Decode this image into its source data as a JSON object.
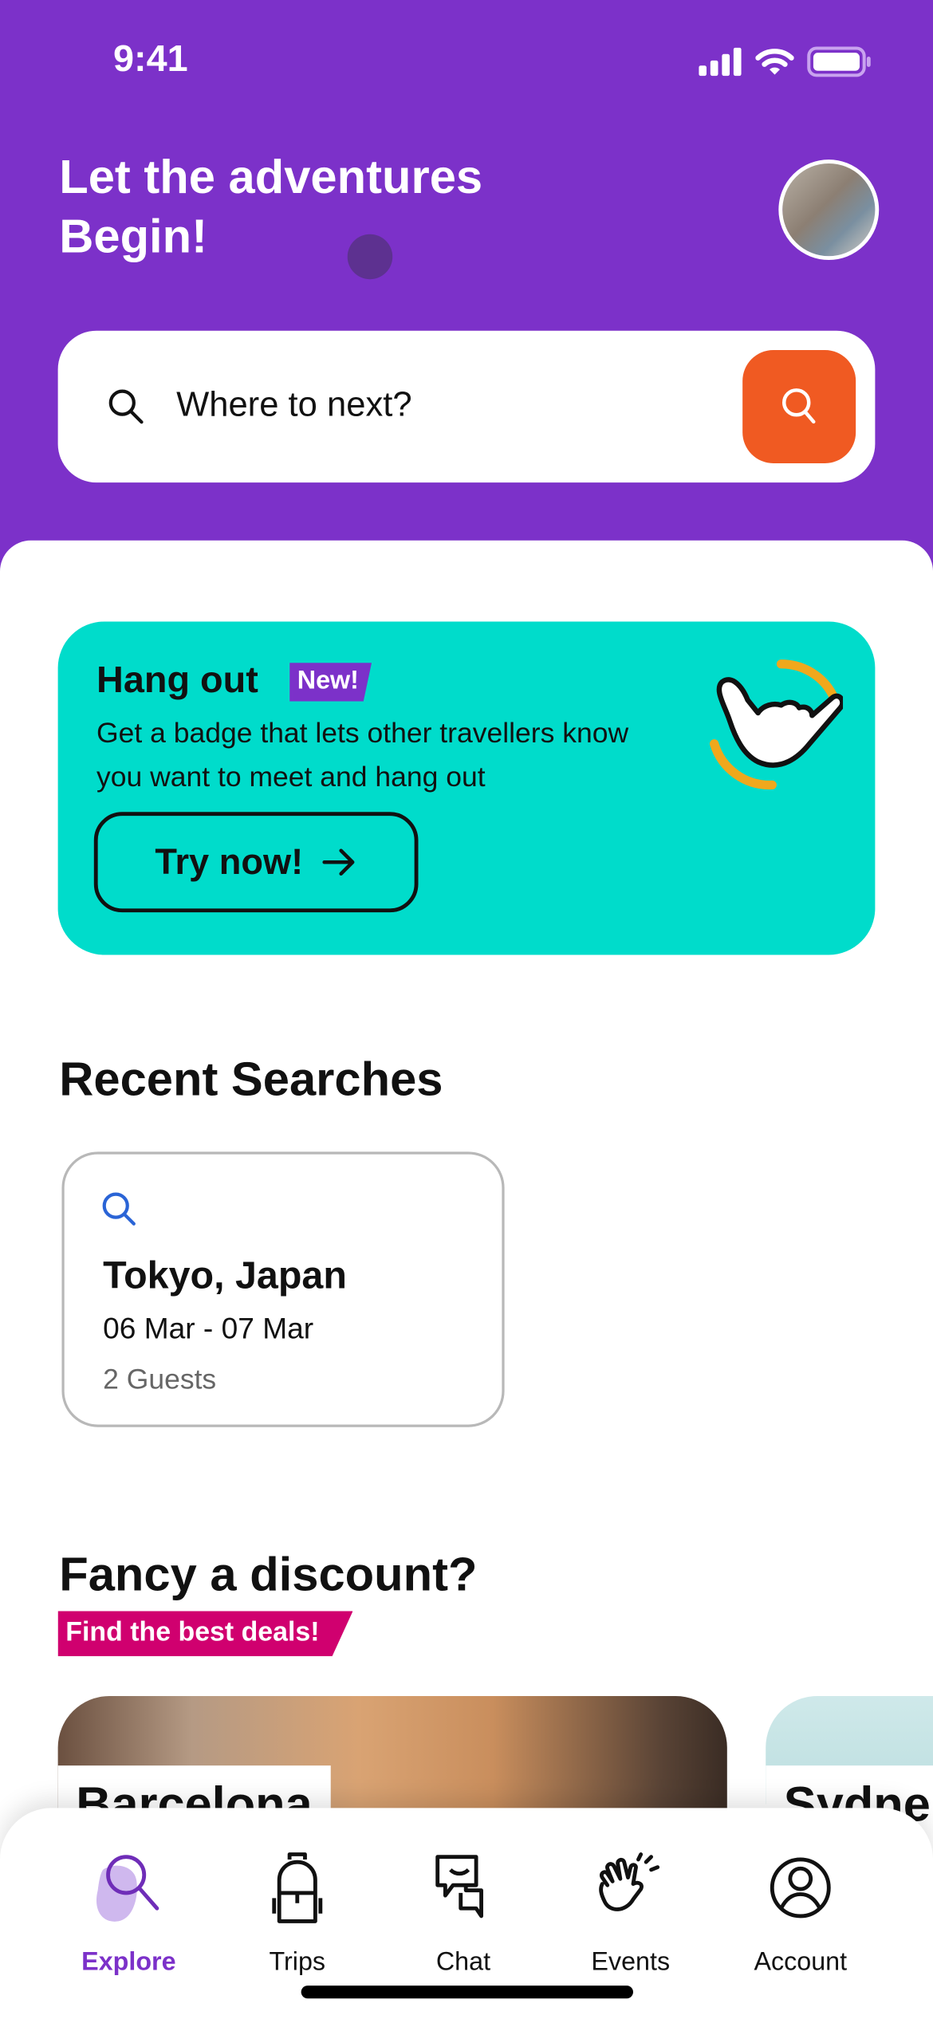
{
  "status_bar": {
    "time": "9:41",
    "icons": [
      "signal-icon",
      "wifi-icon",
      "battery-icon"
    ]
  },
  "header": {
    "title_line1": "Let the adventures",
    "title_line2": "Begin!",
    "avatar": "user-avatar"
  },
  "search": {
    "placeholder": "Where to next?",
    "button_icon": "search-icon"
  },
  "promo": {
    "title": "Hang out",
    "badge": "New!",
    "description": "Get a badge that lets other travellers know you want to meet and hang out",
    "button_label": "Try now!",
    "icon": "shaka-hand-icon"
  },
  "recent": {
    "heading": "Recent Searches",
    "items": [
      {
        "city": "Tokyo, Japan",
        "dates": "06 Mar - 07 Mar",
        "guests": "2 Guests"
      }
    ]
  },
  "discount": {
    "heading": "Fancy a discount?",
    "tag": "Find the best deals!",
    "cards": [
      {
        "label": "Barcelona"
      },
      {
        "label": "Sydne"
      }
    ]
  },
  "tabs": [
    {
      "label": "Explore",
      "icon": "search-icon",
      "active": true
    },
    {
      "label": "Trips",
      "icon": "backpack-icon"
    },
    {
      "label": "Chat",
      "icon": "chat-icon"
    },
    {
      "label": "Events",
      "icon": "waving-hands-icon"
    },
    {
      "label": "Account",
      "icon": "account-icon"
    }
  ],
  "colors": {
    "primary": "#7c31c9",
    "accent": "#f05a22",
    "promo": "#00dccb",
    "deal": "#d0006f"
  }
}
